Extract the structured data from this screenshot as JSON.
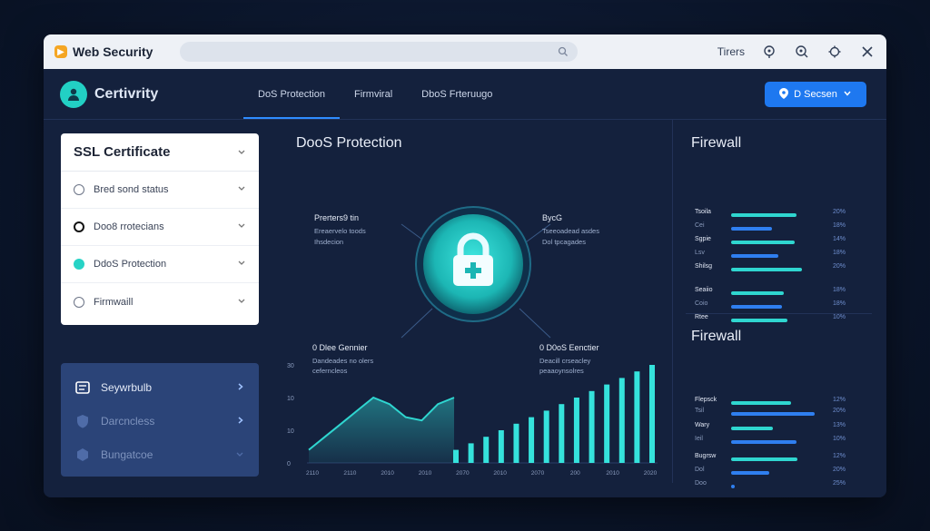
{
  "window": {
    "brand": "Web Security",
    "actions": {
      "text": "Tirers"
    }
  },
  "nav": {
    "app_name": "Certivrity",
    "tabs": [
      {
        "label": "DoS Protection",
        "active": true
      },
      {
        "label": "Firmviral",
        "active": false
      },
      {
        "label": "DbοS Frteruugo",
        "active": false
      }
    ],
    "button_label": "D Secsen"
  },
  "ssl": {
    "title": "SSL Certificate",
    "items": [
      {
        "label": "Bred sond status",
        "state": "empty"
      },
      {
        "label": "Doo8 rrotecians",
        "state": "dark"
      },
      {
        "label": "DdoS Protection",
        "state": "filled"
      },
      {
        "label": "Firmwaill",
        "state": "empty"
      }
    ]
  },
  "side": {
    "items": [
      {
        "label": "Seywrbulb",
        "icon": "list-icon"
      },
      {
        "label": "Darcncless",
        "icon": "shield-icon"
      },
      {
        "label": "Bungatcoe",
        "icon": "hexagon-icon"
      }
    ]
  },
  "center": {
    "title": "DooS Protection",
    "annotations": {
      "tl_title": "Prerters9 tin",
      "tl_sub1": "Ereaervelo toods",
      "tl_sub2": "Ihsdecion",
      "tr_title": "BycG",
      "tr_sub1": "Tseeoadead asdes",
      "tr_sub2": "Dol tpcagades",
      "bl_title": "0 Dlee Gennier",
      "bl_sub1": "Dandeades no olers",
      "bl_sub2": "ceferncleos",
      "br_title": "0 D0oS Eenctier",
      "br_sub1": "Deacill crseacley",
      "br_sub2": "peaaoynsolres"
    }
  },
  "chart_data": {
    "type": "area",
    "ytick_labels": [
      "30",
      "10",
      "10",
      "0"
    ],
    "xtick_labels": [
      "2110",
      "2110",
      "2010",
      "2010",
      "2070",
      "2010",
      "2070",
      "200",
      "2010",
      "2020"
    ],
    "area_series": [
      4,
      8,
      12,
      16,
      20,
      18,
      14,
      13,
      18,
      20
    ],
    "bar_series": [
      4,
      6,
      8,
      10,
      12,
      14,
      16,
      18,
      20,
      22,
      24,
      26,
      28,
      30
    ],
    "colors": {
      "area": "#2fd6d0",
      "bars": "#35e2dc"
    }
  },
  "firewall1": {
    "title": "Firewall",
    "rows": [
      {
        "label": "Tsoila",
        "value": 0.72,
        "text": "20%",
        "small": false
      },
      {
        "label": "Cei",
        "value": 0.45,
        "text": "18%",
        "small": true
      },
      {
        "label": "Sgpie",
        "value": 0.7,
        "text": "14%",
        "small": false
      },
      {
        "label": "Lsv",
        "value": 0.52,
        "text": "18%",
        "small": true
      },
      {
        "label": "Shilsg",
        "value": 0.78,
        "text": "20%",
        "small": false
      },
      {
        "label": "Seaiio",
        "value": 0.58,
        "text": "18%",
        "small": false
      },
      {
        "label": "Coio",
        "value": 0.56,
        "text": "18%",
        "small": true
      },
      {
        "label": "Rtee",
        "value": 0.62,
        "text": "10%",
        "small": false
      }
    ]
  },
  "firewall2": {
    "title": "Firewall",
    "rows": [
      {
        "label": "Flepsck",
        "value": 0.66,
        "text": "12%",
        "small": false
      },
      {
        "label": "Tsil",
        "value": 0.92,
        "text": "20%",
        "small": true
      },
      {
        "label": "Wary",
        "value": 0.46,
        "text": "13%",
        "small": false
      },
      {
        "label": "Ieil",
        "value": 0.72,
        "text": "10%",
        "small": true
      },
      {
        "label": "Bugrsw",
        "value": 0.73,
        "text": "12%",
        "small": false
      },
      {
        "label": "Dol",
        "value": 0.42,
        "text": "20%",
        "small": true
      },
      {
        "label": "Doo",
        "value": 0.04,
        "text": "25%",
        "small": true
      }
    ]
  }
}
